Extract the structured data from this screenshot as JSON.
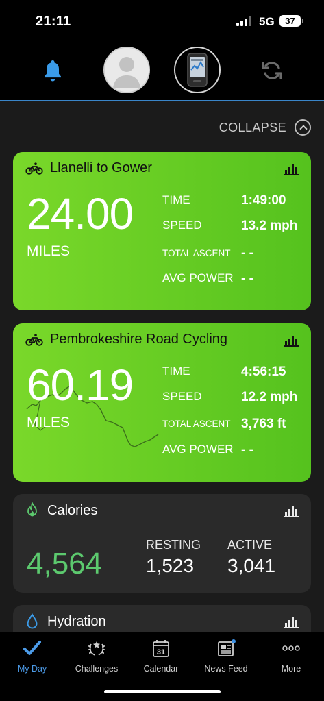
{
  "status_bar": {
    "time": "21:11",
    "network": "5G",
    "battery": "37"
  },
  "header": {
    "icons": [
      "bell-icon",
      "avatar",
      "device-icon",
      "sync-icon"
    ]
  },
  "collapse": {
    "label": "COLLAPSE"
  },
  "activities": [
    {
      "title": "Llanelli to Gower",
      "distance": "24.00",
      "unit": "MILES",
      "metrics": [
        {
          "label": "TIME",
          "value": "1:49:00"
        },
        {
          "label": "SPEED",
          "value": "13.2 mph"
        },
        {
          "label": "TOTAL ASCENT",
          "value": "- -"
        },
        {
          "label": "AVG POWER",
          "value": "- -"
        }
      ]
    },
    {
      "title": "Pembrokeshire Road Cycling",
      "distance": "60.19",
      "unit": "MILES",
      "metrics": [
        {
          "label": "TIME",
          "value": "4:56:15"
        },
        {
          "label": "SPEED",
          "value": "12.2 mph"
        },
        {
          "label": "TOTAL ASCENT",
          "value": "3,763 ft"
        },
        {
          "label": "AVG POWER",
          "value": "- -"
        }
      ]
    }
  ],
  "calories": {
    "title": "Calories",
    "total": "4,564",
    "resting_label": "RESTING",
    "resting": "1,523",
    "active_label": "ACTIVE",
    "active": "3,041"
  },
  "hydration": {
    "title": "Hydration"
  },
  "tabs": [
    {
      "label": "My Day",
      "icon": "check-icon",
      "active": true
    },
    {
      "label": "Challenges",
      "icon": "laurel-icon"
    },
    {
      "label": "Calendar",
      "icon": "calendar-icon",
      "day": "31"
    },
    {
      "label": "News Feed",
      "icon": "newspaper-icon"
    },
    {
      "label": "More",
      "icon": "more-icon"
    }
  ],
  "colors": {
    "accent": "#3a85c9",
    "ride_card": "#6acd25",
    "calories_green": "#5cc96e"
  }
}
